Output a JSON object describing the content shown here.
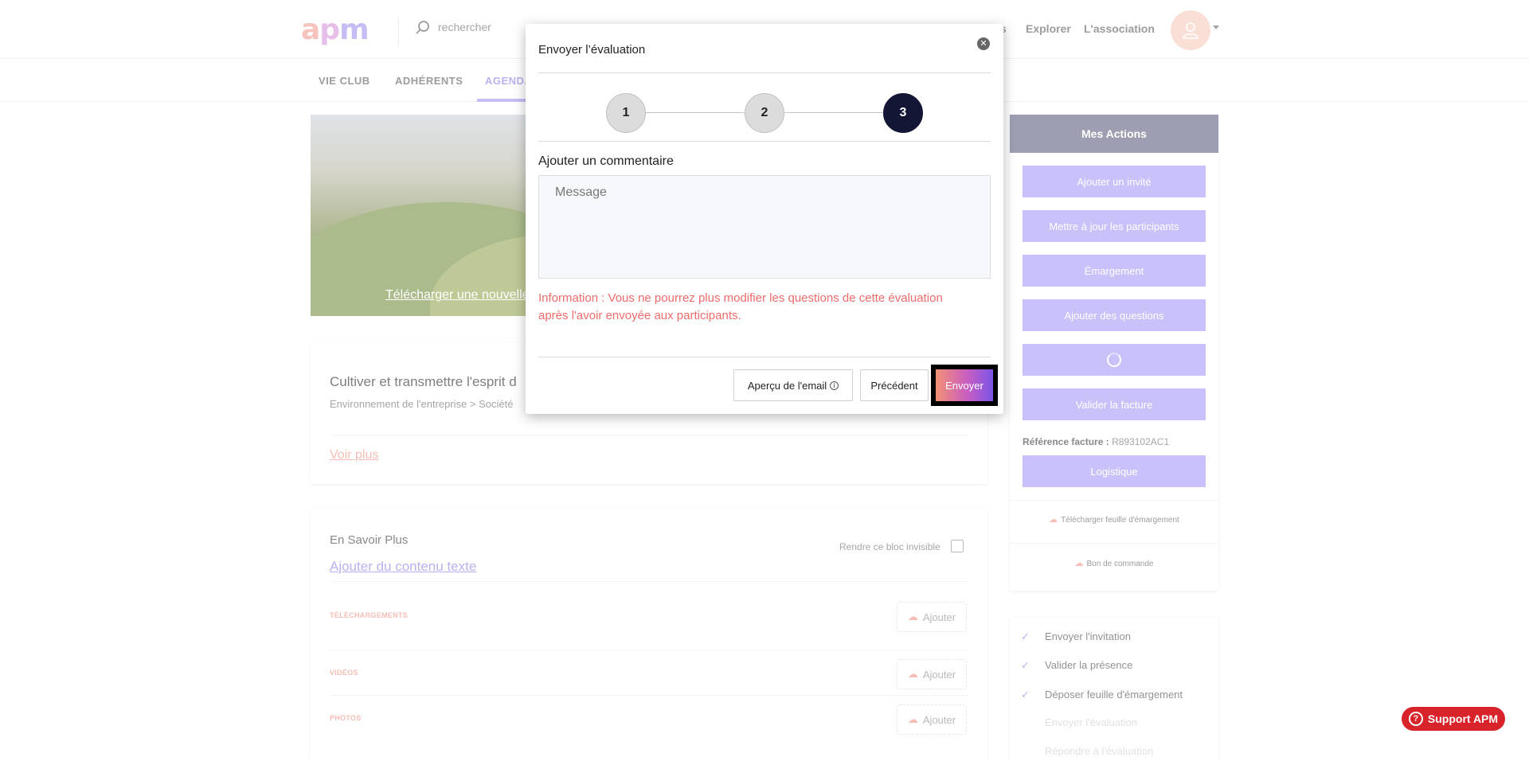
{
  "header": {
    "logo": "apm",
    "search_placeholder": "rechercher",
    "nav": [
      "s",
      "Explorer",
      "L'association"
    ]
  },
  "subnav": {
    "items": [
      "VIE CLUB",
      "ADHÉRENTS",
      "AGENDA"
    ],
    "active": "AGENDA"
  },
  "hero": {
    "upload_link": "Télécharger une nouvelle"
  },
  "event_card": {
    "title": "Cultiver et transmettre l'esprit d",
    "breadcrumb": "Environnement de l'entreprise > Société",
    "more_link": "Voir plus"
  },
  "more_card": {
    "title": "En Savoir Plus",
    "add_text_link": "Ajouter du contenu texte",
    "invisible_label": "Rendre ce bloc invisible",
    "sections": [
      {
        "label": "TÉLÉCHARGEMENTS",
        "button": "Ajouter"
      },
      {
        "label": "VIDÉOS",
        "button": "Ajouter"
      },
      {
        "label": "PHOTOS",
        "button": "Ajouter"
      }
    ]
  },
  "actions": {
    "title": "Mes Actions",
    "buttons": [
      "Ajouter un invité",
      "Mettre à jour les participants",
      "Émargement",
      "Ajouter des questions",
      "",
      "Valider la facture"
    ],
    "ref_label": "Référence facture :",
    "ref_value": "R893102AC1",
    "logistics": "Logistique",
    "download_sheet": "Télécharger feuille d'émargement",
    "purchase_order": "Bon de commande"
  },
  "steps": {
    "items": [
      {
        "label": "Envoyer l'invitation",
        "done": true
      },
      {
        "label": "Valider la présence",
        "done": true
      },
      {
        "label": "Déposer feuille d'émargement",
        "done": true
      },
      {
        "label": "Envoyer l'évaluation",
        "done": false
      },
      {
        "label": "Répondre à l'évaluation",
        "done": false
      }
    ]
  },
  "support": {
    "label": "Support APM"
  },
  "modal": {
    "title": "Envoyer l’évaluation",
    "steps": [
      "1",
      "2",
      "3"
    ],
    "active_step": "3",
    "comment_label": "Ajouter un commentaire",
    "comment_placeholder": "Message",
    "info": "Information : Vous ne pourrez plus modifier les questions de cette évaluation après l'avoir envoyée aux participants.",
    "preview_button": "Aperçu de l'email",
    "prev_button": "Précédent",
    "send_button": "Envoyer"
  },
  "colors": {
    "accent": "#a395f7",
    "dark": "#141636",
    "warning": "#ef6c6c",
    "support": "#d9232a"
  }
}
